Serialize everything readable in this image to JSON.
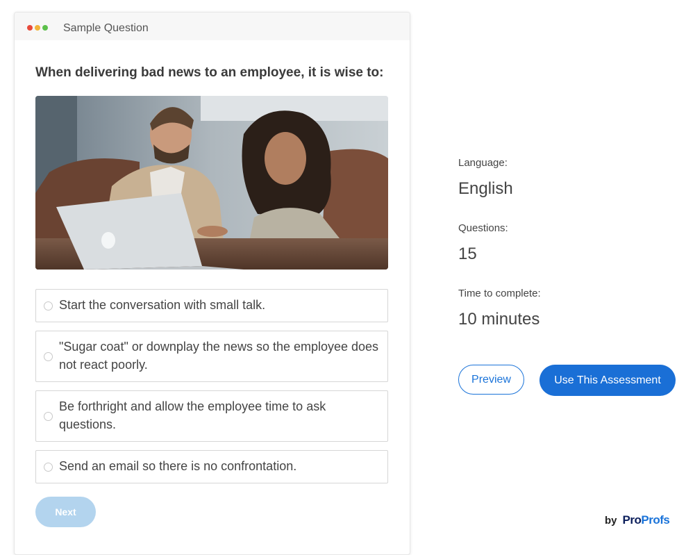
{
  "card": {
    "title": "Sample Question",
    "window_dots": [
      "#e84a3b",
      "#f2b43a",
      "#5cc04b"
    ]
  },
  "question": {
    "text": "When delivering bad news to an employee, it is wise to:",
    "image_icon": "photo-two-people-laptop",
    "options": [
      {
        "label": "Start the conversation with small talk."
      },
      {
        "label": "\"Sugar coat\" or downplay the news so the employee does not react poorly."
      },
      {
        "label": "Be forthright and allow the employee time to ask questions."
      },
      {
        "label": "Send an email so there is no confrontation."
      }
    ],
    "next_label": "Next"
  },
  "meta": {
    "language_label": "Language:",
    "language_value": "English",
    "questions_label": "Questions:",
    "questions_value": "15",
    "time_label": "Time to complete:",
    "time_value": "10 minutes"
  },
  "actions": {
    "preview_label": "Preview",
    "use_label": "Use This Assessment"
  },
  "brand": {
    "by": "by",
    "logo_pro": "Pro",
    "logo_profs": "Profs",
    "colors": {
      "pro": "#0b1e5b",
      "profs": "#1a73d9"
    }
  },
  "colors": {
    "accent": "#1a6fd6",
    "next_disabled": "#b3d4ee"
  }
}
